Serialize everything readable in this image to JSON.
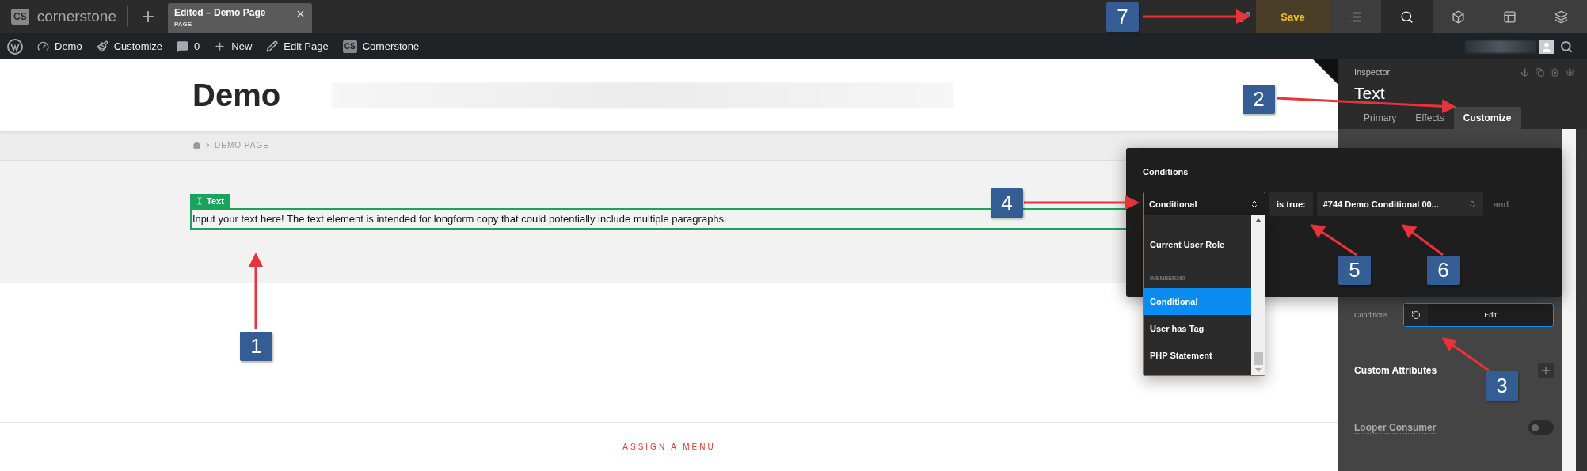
{
  "top_bar": {
    "logo_mark": "CS",
    "logo": "cornerstone",
    "new_button": "+",
    "tab": {
      "title": "Edited – Demo Page",
      "subtitle": "PAGE"
    },
    "save": "Save",
    "tools": [
      {
        "kind": "list",
        "selected": false
      },
      {
        "kind": "search",
        "selected": true
      },
      {
        "kind": "cube",
        "selected": false
      },
      {
        "kind": "layout",
        "selected": false
      },
      {
        "kind": "layers",
        "selected": false
      }
    ]
  },
  "admin_bar": {
    "items": [
      {
        "kind": "wordpress"
      },
      {
        "kind": "dashboard",
        "label": "Demo"
      },
      {
        "kind": "brush",
        "label": "Customize"
      },
      {
        "kind": "comment",
        "label": "0"
      },
      {
        "kind": "plus",
        "label": "New"
      },
      {
        "kind": "pencil",
        "label": "Edit Page"
      },
      {
        "kind": "cs",
        "mark": "CS",
        "label": "Cornerstone"
      }
    ]
  },
  "page": {
    "site_title": "Demo",
    "breadcrumb": "DEMO PAGE",
    "element_tag": "Text",
    "text": "Input your text here! The text element is intended for longform copy that could potentially include multiple paragraphs.",
    "menu_link": "ASSIGN A MENU"
  },
  "inspector": {
    "heading": "Inspector",
    "title": "Text",
    "tabs": [
      {
        "label": "Primary",
        "selected": false
      },
      {
        "label": "Effects",
        "selected": false
      },
      {
        "label": "Customize",
        "selected": true
      }
    ],
    "conditions_label": "Conditions",
    "conditions_button": "Edit",
    "custom_attributes": "Custom Attributes",
    "looper": {
      "label": "Looper Consumer",
      "on": false
    }
  },
  "conditions_popup": {
    "title": "Conditions",
    "type_select": "Conditional",
    "operator": "is true:",
    "value_select": "#744 Demo Conditional 00...",
    "joiner": "and",
    "options": [
      {
        "kind": "option",
        "label": "Current User Role",
        "selected": false
      },
      {
        "kind": "group",
        "label": "IMEMBER360"
      },
      {
        "kind": "option",
        "label": "Conditional",
        "selected": true
      },
      {
        "kind": "option",
        "label": "User has Tag",
        "selected": false
      },
      {
        "kind": "option",
        "label": "PHP Statement",
        "selected": false
      }
    ]
  },
  "annotations": [
    {
      "label": "1"
    },
    {
      "label": "2"
    },
    {
      "label": "3"
    },
    {
      "label": "4"
    },
    {
      "label": "5"
    },
    {
      "label": "6"
    },
    {
      "label": "7"
    }
  ]
}
